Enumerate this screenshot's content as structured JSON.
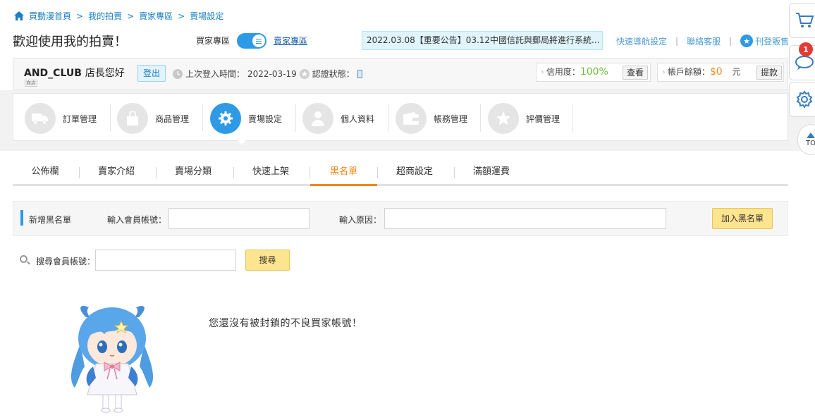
{
  "breadcrumb": {
    "items": [
      "買動漫首頁",
      "我的拍賣",
      "賣家專區",
      "賣場設定"
    ],
    "separator": ">"
  },
  "header": {
    "welcome": "歡迎使用我的拍賣！",
    "buyer_zone": "買家專區",
    "seller_zone": "賣家專區",
    "notice": "2022.03.08【重要公告】03.12中國信託與郵局將進行系統...",
    "links": [
      "快速導航設定",
      "聯絡客服",
      "刊登販售"
    ]
  },
  "account": {
    "shop_name": "AND_CLUB",
    "greeting": "店長您好",
    "shop_tag": "商店",
    "logout": "登出",
    "last_login_label": "上次登入時間：",
    "last_login": "2022-03-19",
    "verify_label": "認證狀態：",
    "credit_label": "信用度：",
    "credit_value": "100%",
    "view_button": "查看",
    "balance_label": "帳戶餘額：",
    "balance_value": "$0",
    "balance_unit": "元",
    "withdraw_button": "提款"
  },
  "menu": {
    "items": [
      {
        "label": "訂單管理",
        "icon": "truck-icon"
      },
      {
        "label": "商品管理",
        "icon": "bag-icon"
      },
      {
        "label": "賣場設定",
        "icon": "gear-icon"
      },
      {
        "label": "個人資料",
        "icon": "person-icon"
      },
      {
        "label": "帳務管理",
        "icon": "wallet-icon"
      },
      {
        "label": "評價管理",
        "icon": "star-icon"
      }
    ],
    "active_index": 2
  },
  "tabs": {
    "items": [
      "公佈欄",
      "賣家介紹",
      "賣場分類",
      "快速上架",
      "黑名單",
      "超商設定",
      "滿額運費"
    ],
    "active_index": 4
  },
  "blacklist": {
    "title": "新增黑名單",
    "member_label": "輸入會員帳號：",
    "member_value": "",
    "reason_label": "輸入原因：",
    "reason_value": "",
    "add_button": "加入黑名單"
  },
  "search": {
    "label": "搜尋會員帳號：",
    "value": "",
    "button": "搜尋"
  },
  "empty_message": "您還沒有被封鎖的不良買家帳號！",
  "rail": {
    "badge_count": "1",
    "top_label": "TO"
  },
  "colors": {
    "accent_blue": "#2e9ae5",
    "accent_orange": "#f0881a",
    "credit_green": "#6cbd3a",
    "button_yellow": "#fde48e",
    "badge_red": "#e53935"
  }
}
